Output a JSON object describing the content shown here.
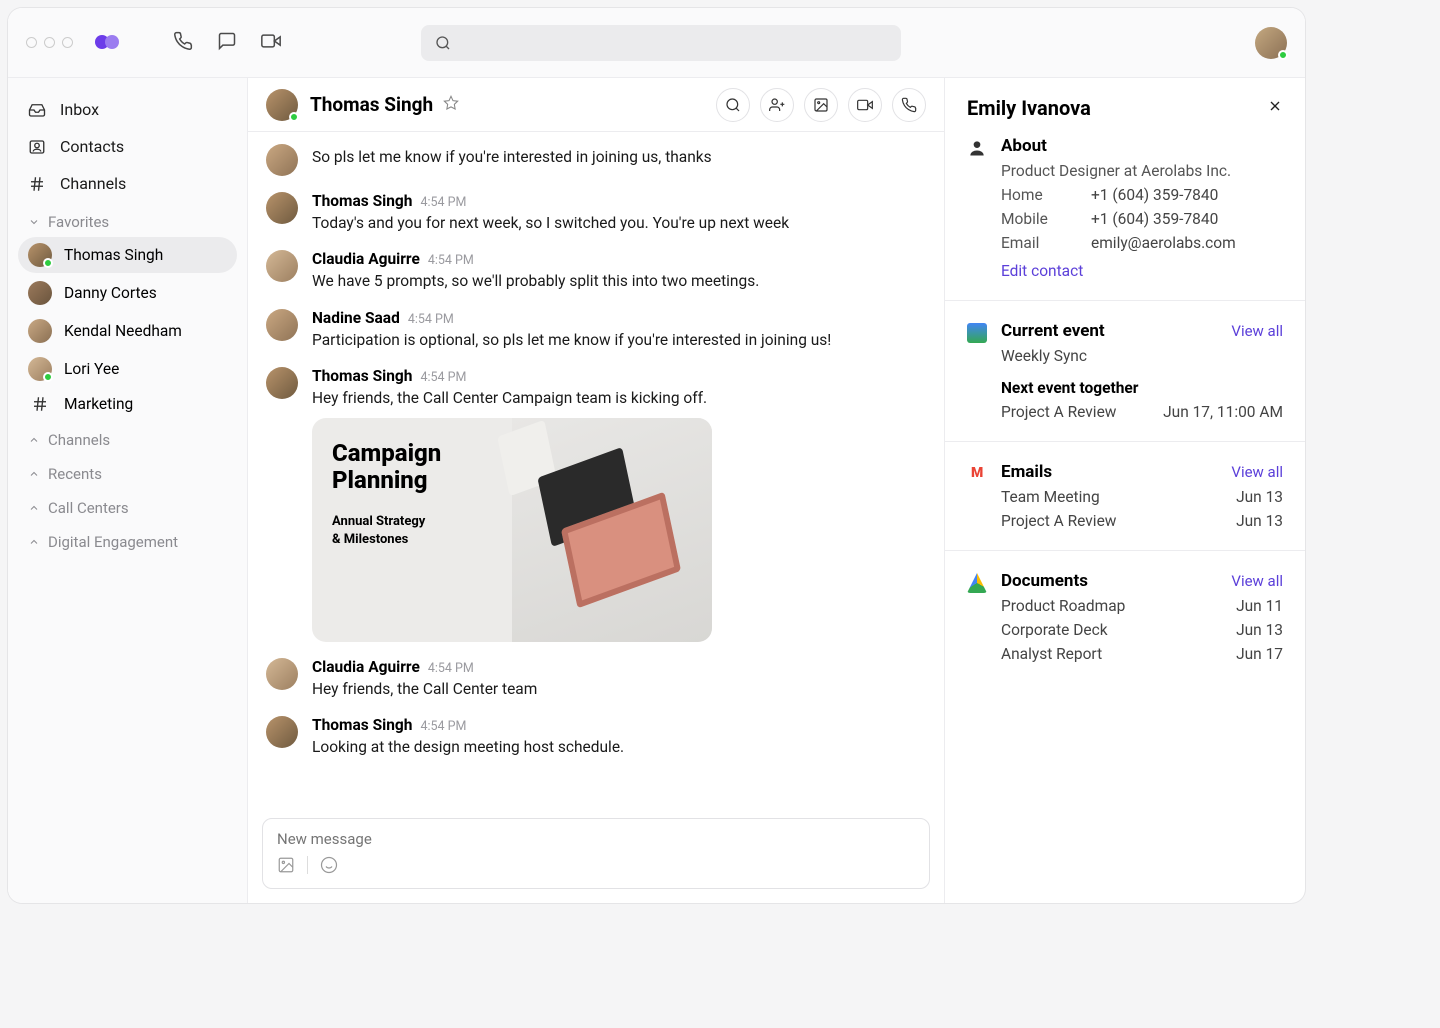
{
  "sidebar": {
    "nav": [
      {
        "label": "Inbox",
        "icon": "inbox"
      },
      {
        "label": "Contacts",
        "icon": "contacts"
      },
      {
        "label": "Channels",
        "icon": "hash"
      }
    ],
    "favorites_label": "Favorites",
    "favorites": [
      {
        "label": "Thomas Singh",
        "active": true,
        "presence": true
      },
      {
        "label": "Danny Cortes"
      },
      {
        "label": "Kendal Needham"
      },
      {
        "label": "Lori Yee",
        "presence": true
      },
      {
        "label": "Marketing",
        "hash": true
      }
    ],
    "sections": [
      "Channels",
      "Recents",
      "Call Centers",
      "Digital Engagement"
    ]
  },
  "conversation": {
    "title": "Thomas Singh",
    "messages": [
      {
        "text": "So pls let me know if you're interested in joining us, thanks"
      },
      {
        "name": "Thomas Singh",
        "time": "4:54 PM",
        "text": "Today's and you for next week, so I switched you. You're up next week",
        "av": "av-1"
      },
      {
        "name": "Claudia Aguirre",
        "time": "4:54 PM",
        "text": "We have 5 prompts, so we'll probably split this into two meetings.",
        "av": "av-4"
      },
      {
        "name": "Nadine Saad",
        "time": "4:54 PM",
        "text": "Participation is optional, so pls let me know if you're interested in joining us!",
        "av": "av-5"
      },
      {
        "name": "Thomas Singh",
        "time": "4:54 PM",
        "text": "Hey friends, the Call Center Campaign team is kicking off.",
        "av": "av-1",
        "card": true
      },
      {
        "name": "Claudia Aguirre",
        "time": "4:54 PM",
        "text": "Hey friends, the Call Center team",
        "av": "av-4"
      },
      {
        "name": "Thomas Singh",
        "time": "4:54 PM",
        "text": "Looking at the design meeting host schedule.",
        "av": "av-1"
      }
    ],
    "card": {
      "title": "Campaign Planning",
      "sub1": "Annual Strategy",
      "sub2": "& Milestones"
    },
    "composer_placeholder": "New message"
  },
  "panel": {
    "name": "Emily Ivanova",
    "about_label": "About",
    "role": "Product Designer at Aerolabs Inc.",
    "fields": [
      {
        "k": "Home",
        "v": "+1 (604) 359-7840"
      },
      {
        "k": "Mobile",
        "v": "+1 (604) 359-7840"
      },
      {
        "k": "Email",
        "v": "emily@aerolabs.com"
      }
    ],
    "edit": "Edit contact",
    "view_all": "View all",
    "calendar": {
      "title": "Current event",
      "current": "Weekly Sync",
      "next_label": "Next event together",
      "next_name": "Project A Review",
      "next_time": "Jun 17, 11:00 AM"
    },
    "emails": {
      "title": "Emails",
      "items": [
        {
          "name": "Team Meeting",
          "date": "Jun 13"
        },
        {
          "name": "Project A Review",
          "date": "Jun 13"
        }
      ]
    },
    "docs": {
      "title": "Documents",
      "items": [
        {
          "name": "Product Roadmap",
          "date": "Jun 11"
        },
        {
          "name": "Corporate Deck",
          "date": "Jun 13"
        },
        {
          "name": "Analyst Report",
          "date": "Jun 17"
        }
      ]
    }
  }
}
